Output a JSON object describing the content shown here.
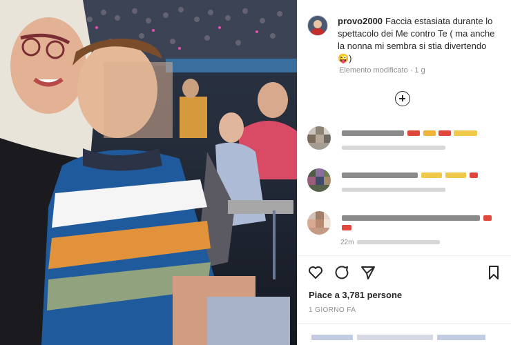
{
  "post": {
    "username": "provo2000",
    "caption": "Faccia estasiata durante lo spettacolo dei Me contro Te ( ma anche la nonna mi sembra si stia divertendo 😜)",
    "meta": "Elemento modificato · 1 g",
    "likes": "Piace a 3,781 persone",
    "time": "1 GIORNO FA"
  },
  "comments_preview": {
    "timestamp_partial": "22m"
  },
  "icons": [
    "add-comment-icon",
    "like-icon",
    "comment-icon",
    "share-icon",
    "save-icon"
  ],
  "colors": {
    "text": "#262626",
    "muted": "#8e8e8e",
    "divider": "#efefef"
  }
}
